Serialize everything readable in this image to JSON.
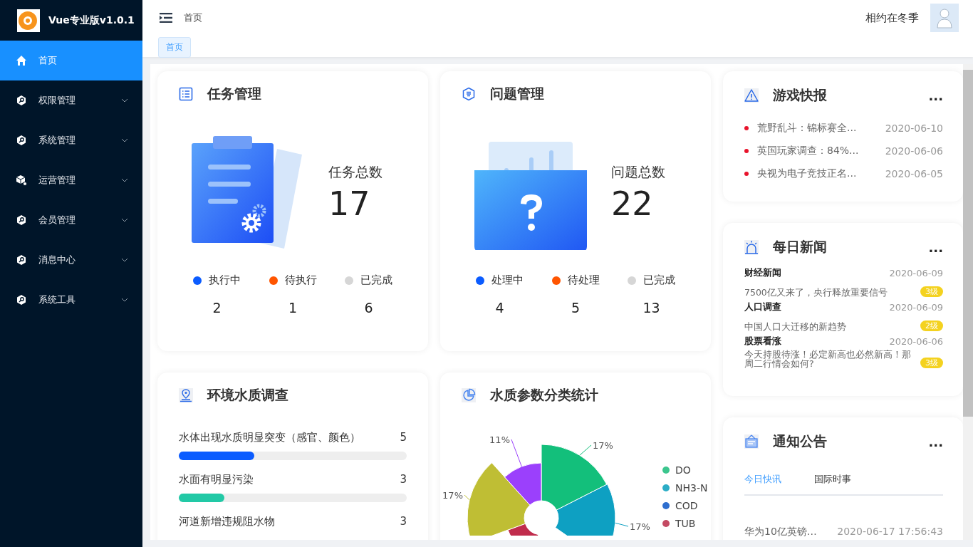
{
  "sidebar": {
    "brand": "Vue专业版v1.0.1",
    "items": [
      {
        "label": "首页",
        "kind": "home",
        "selected": true,
        "expandable": false
      },
      {
        "label": "权限管理",
        "kind": "module",
        "selected": false,
        "expandable": true
      },
      {
        "label": "系统管理",
        "kind": "module",
        "selected": false,
        "expandable": true
      },
      {
        "label": "运营管理",
        "kind": "cube",
        "selected": false,
        "expandable": true
      },
      {
        "label": "会员管理",
        "kind": "module",
        "selected": false,
        "expandable": true
      },
      {
        "label": "消息中心",
        "kind": "module",
        "selected": false,
        "expandable": true
      },
      {
        "label": "系统工具",
        "kind": "module",
        "selected": false,
        "expandable": true
      }
    ]
  },
  "header": {
    "breadcrumb": "首页",
    "user_name": "相约在冬季"
  },
  "tags": [
    {
      "label": "首页",
      "selected": true
    }
  ],
  "task_card": {
    "title": "任务管理",
    "total_label": "任务总数",
    "total": "17",
    "stats": [
      {
        "label": "执行中",
        "value": "2",
        "color": "#0b5cff"
      },
      {
        "label": "待执行",
        "value": "1",
        "color": "#ff5500"
      },
      {
        "label": "已完成",
        "value": "6",
        "color": "#d6d6d6"
      }
    ]
  },
  "issue_card": {
    "title": "问题管理",
    "total_label": "问题总数",
    "total": "22",
    "stats": [
      {
        "label": "处理中",
        "value": "4",
        "color": "#0b5cff"
      },
      {
        "label": "待处理",
        "value": "5",
        "color": "#ff5500"
      },
      {
        "label": "已完成",
        "value": "13",
        "color": "#d6d6d6"
      }
    ]
  },
  "game_news": {
    "title": "游戏快报",
    "more": "...",
    "items": [
      {
        "title": "荒野乱斗：锦标赛全...",
        "date": "2020-06-10"
      },
      {
        "title": "英国玩家调查：84%...",
        "date": "2020-06-06"
      },
      {
        "title": "央视为电子竞技正名...",
        "date": "2020-06-05"
      }
    ]
  },
  "daily_news": {
    "title": "每日新闻",
    "more": "...",
    "items": [
      {
        "category": "财经新闻",
        "date": "2020-06-09",
        "text": "7500亿又来了，央行释放重要信号",
        "level": "3级"
      },
      {
        "category": "人口调查",
        "date": "2020-06-09",
        "text": "中国人口大迁移的新趋势",
        "level": "2级"
      },
      {
        "category": "股票看涨",
        "date": "2020-06-06",
        "text": "今天持股待涨！必定新高也必然新高！那周二行情会如何?",
        "level": "3级"
      }
    ]
  },
  "notice": {
    "title": "通知公告",
    "more": "...",
    "tabs": [
      {
        "label": "今日快讯",
        "selected": true
      },
      {
        "label": "国际时事",
        "selected": false
      }
    ],
    "items": [
      {
        "title": "华为10亿英镑…",
        "date": "2020-06-17 17:56:43"
      }
    ]
  },
  "water_survey": {
    "title": "环境水质调查",
    "items": [
      {
        "label": "水体出现水质明显突变（感官、颜色）",
        "count": "5",
        "level": 0.33,
        "color": "#0b5cff"
      },
      {
        "label": "水面有明显污染",
        "count": "3",
        "level": 0.2,
        "color": "#22c9a6"
      },
      {
        "label": "河道新增违规阻水物",
        "count": "3"
      }
    ]
  },
  "param_chart": {
    "title": "水质参数分类统计",
    "slices": [
      {
        "color": "#13bf7b",
        "label": "17%"
      },
      {
        "color": "#0ea0c2",
        "label": "17%"
      },
      {
        "color": "#c02c4c"
      },
      {
        "color": "#bfbe34",
        "label": "17%"
      },
      {
        "color": "#9b40fc",
        "label": "11%"
      }
    ],
    "legend": [
      {
        "label": "DO",
        "color": "#3cc68e"
      },
      {
        "label": "NH3-N",
        "color": "#2cadc6"
      },
      {
        "label": "COD",
        "color": "#2f6fcf"
      },
      {
        "label": "TUB",
        "color": "#c44a63"
      }
    ]
  }
}
